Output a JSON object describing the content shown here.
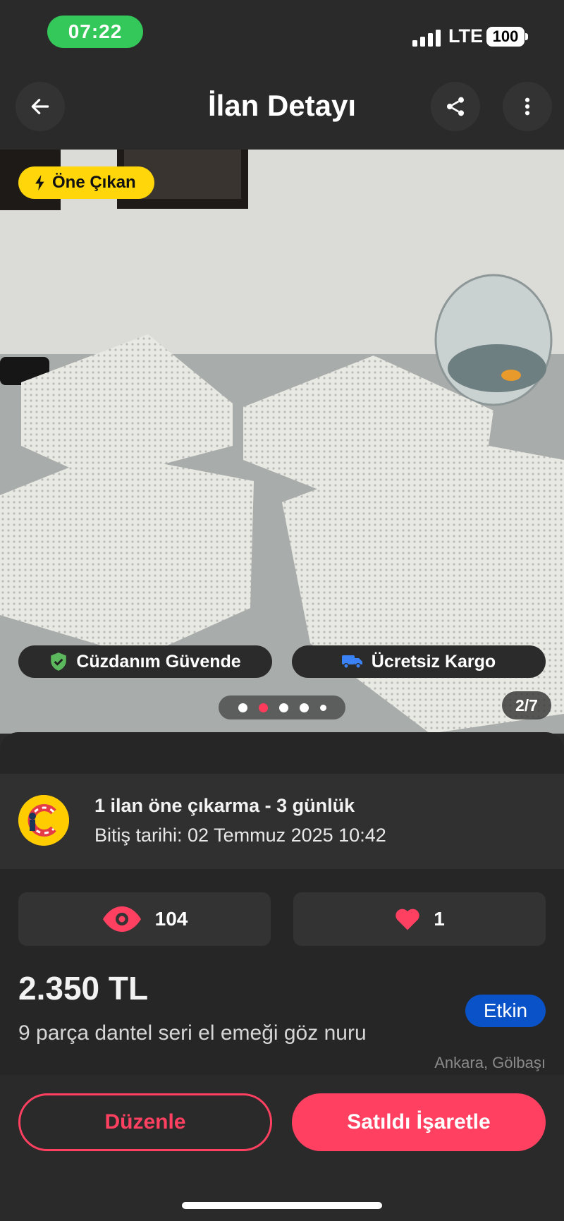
{
  "status_bar": {
    "time": "07:22",
    "network": "LTE",
    "battery": "100"
  },
  "header": {
    "title": "İlan Detayı",
    "back_icon": "arrow-left-icon",
    "share_icon": "share-icon",
    "more_icon": "more-vertical-icon"
  },
  "photo": {
    "featured_badge": "Öne Çıkan",
    "wallet_safe": "Cüzdanım Güvende",
    "free_shipping": "Ücretsiz Kargo",
    "counter": "2/7",
    "dot_count": 5,
    "active_dot": 2
  },
  "promo": {
    "title": "1 ilan öne çıkarma - 3 günlük",
    "expiry": "Bitiş tarihi: 02 Temmuz 2025 10:42"
  },
  "stats": {
    "views": "104",
    "likes": "1"
  },
  "listing": {
    "price": "2.350 TL",
    "description": "9 parça dantel seri el emeği göz nuru",
    "status": "Etkin",
    "location": "Ankara, Gölbaşı"
  },
  "actions": {
    "edit": "Düzenle",
    "mark_sold": "Satıldı İşaretle"
  },
  "colors": {
    "accent": "#ff4060",
    "featured": "#ffd60a",
    "status_chip": "#0a52c7",
    "time_pill": "#34c759"
  }
}
